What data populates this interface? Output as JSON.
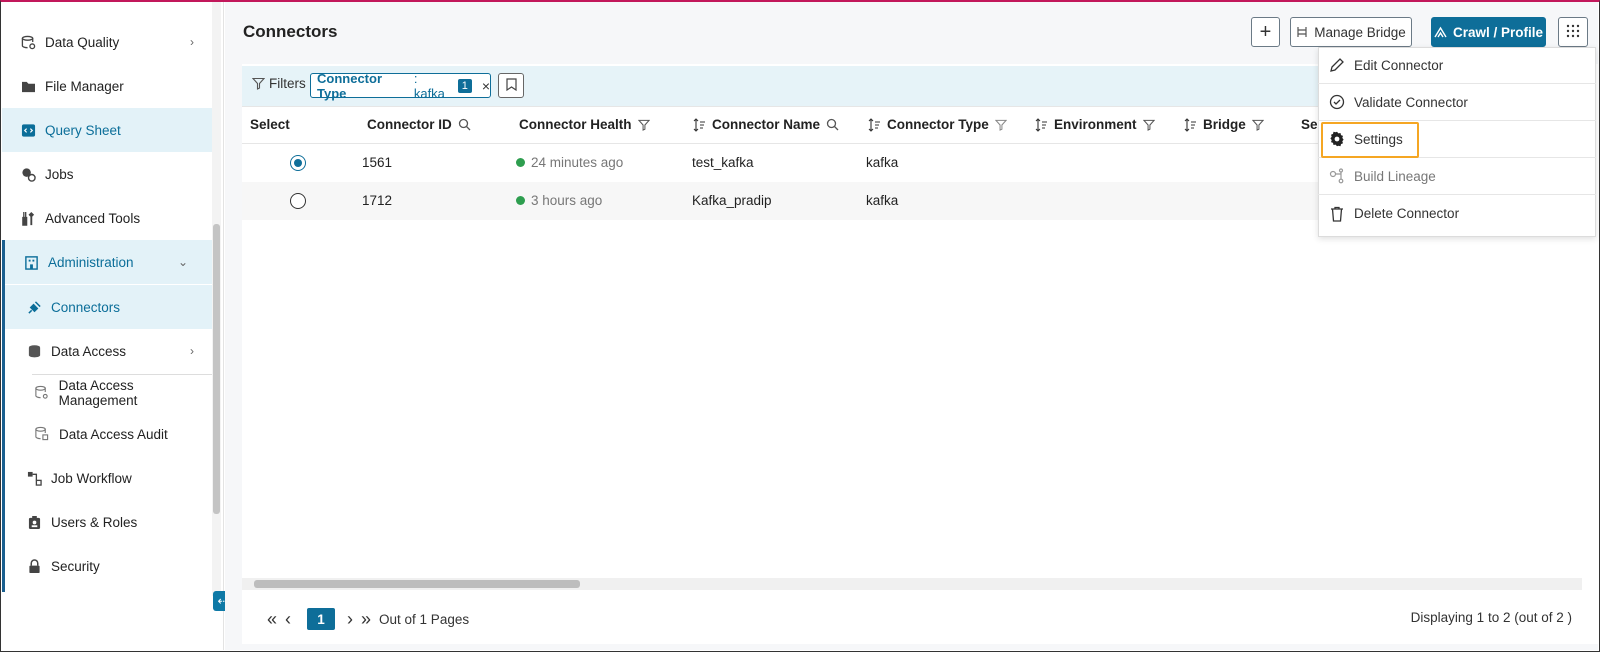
{
  "sidebar": {
    "items": [
      {
        "label": "Data Quality",
        "icon": "data-quality-icon",
        "chevron": "›"
      },
      {
        "label": "File Manager",
        "icon": "folder-icon"
      },
      {
        "label": "Query Sheet",
        "icon": "code-icon"
      },
      {
        "label": "Jobs",
        "icon": "jobs-icon"
      },
      {
        "label": "Advanced Tools",
        "icon": "tools-icon"
      },
      {
        "label": "Administration",
        "icon": "building-icon",
        "chevron": "⌄"
      },
      {
        "label": "Connectors",
        "icon": "plug-icon"
      },
      {
        "label": "Data Access",
        "icon": "database-icon",
        "chevron": "›"
      },
      {
        "label": "Data Access Management",
        "icon": "db-settings-icon"
      },
      {
        "label": "Data Access Audit",
        "icon": "db-audit-icon"
      },
      {
        "label": "Job Workflow",
        "icon": "workflow-icon"
      },
      {
        "label": "Users & Roles",
        "icon": "badge-icon"
      },
      {
        "label": "Security",
        "icon": "lock-icon"
      }
    ],
    "collapse_glyph": "⇠"
  },
  "header": {
    "title": "Connectors",
    "add_label": "+",
    "manage_bridge_label": "Manage Bridge",
    "crawl_label": "Crawl / Profile",
    "grid_menu_label": "⋮⋮"
  },
  "filters": {
    "label": "Filters",
    "chip_key": "Connector Type",
    "chip_value": ": kafka",
    "chip_count": "1",
    "chip_close": "×"
  },
  "table": {
    "columns": [
      "Select",
      "Connector ID",
      "Connector Health",
      "Connector Name",
      "Connector Type",
      "Environment",
      "Bridge",
      "Ser"
    ],
    "rows": [
      {
        "selected": true,
        "id": "1561",
        "health": "24 minutes ago",
        "name": "test_kafka",
        "type": "kafka"
      },
      {
        "selected": false,
        "id": "1712",
        "health": "3 hours ago",
        "name": "Kafka_pradip",
        "type": "kafka"
      }
    ]
  },
  "pagination": {
    "first": "«",
    "prev": "‹",
    "current_page": "1",
    "next": "›",
    "last": "»",
    "out_of": "Out of 1 Pages",
    "displaying": "Displaying 1 to 2  (out of 2 )"
  },
  "menu": {
    "items": [
      {
        "label": "Edit Connector",
        "icon": "pencil-icon"
      },
      {
        "label": "Validate Connector",
        "icon": "check-circle-icon"
      },
      {
        "label": "Settings",
        "icon": "gear-icon"
      },
      {
        "label": "Build Lineage",
        "icon": "lineage-icon"
      },
      {
        "label": "Delete Connector",
        "icon": "trash-icon"
      }
    ]
  },
  "colors": {
    "accent": "#0e6e99",
    "active_bg": "#e3f2f8",
    "highlight": "#f5a623",
    "health_ok": "#2e9e4f"
  }
}
